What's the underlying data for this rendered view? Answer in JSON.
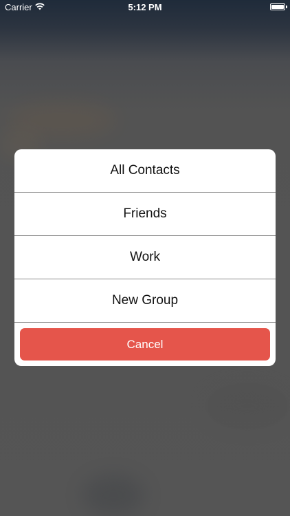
{
  "status_bar": {
    "carrier": "Carrier",
    "time": "5:12 PM",
    "wifi_icon": "wifi-icon",
    "battery_icon": "battery-icon"
  },
  "action_sheet": {
    "options": [
      {
        "label": "All Contacts"
      },
      {
        "label": "Friends"
      },
      {
        "label": "Work"
      },
      {
        "label": "New Group"
      }
    ],
    "cancel_label": "Cancel"
  },
  "colors": {
    "cancel_bg": "#e5554b",
    "sheet_bg": "#ffffff",
    "separator": "#8a8a8a",
    "overlay": "#555555"
  }
}
